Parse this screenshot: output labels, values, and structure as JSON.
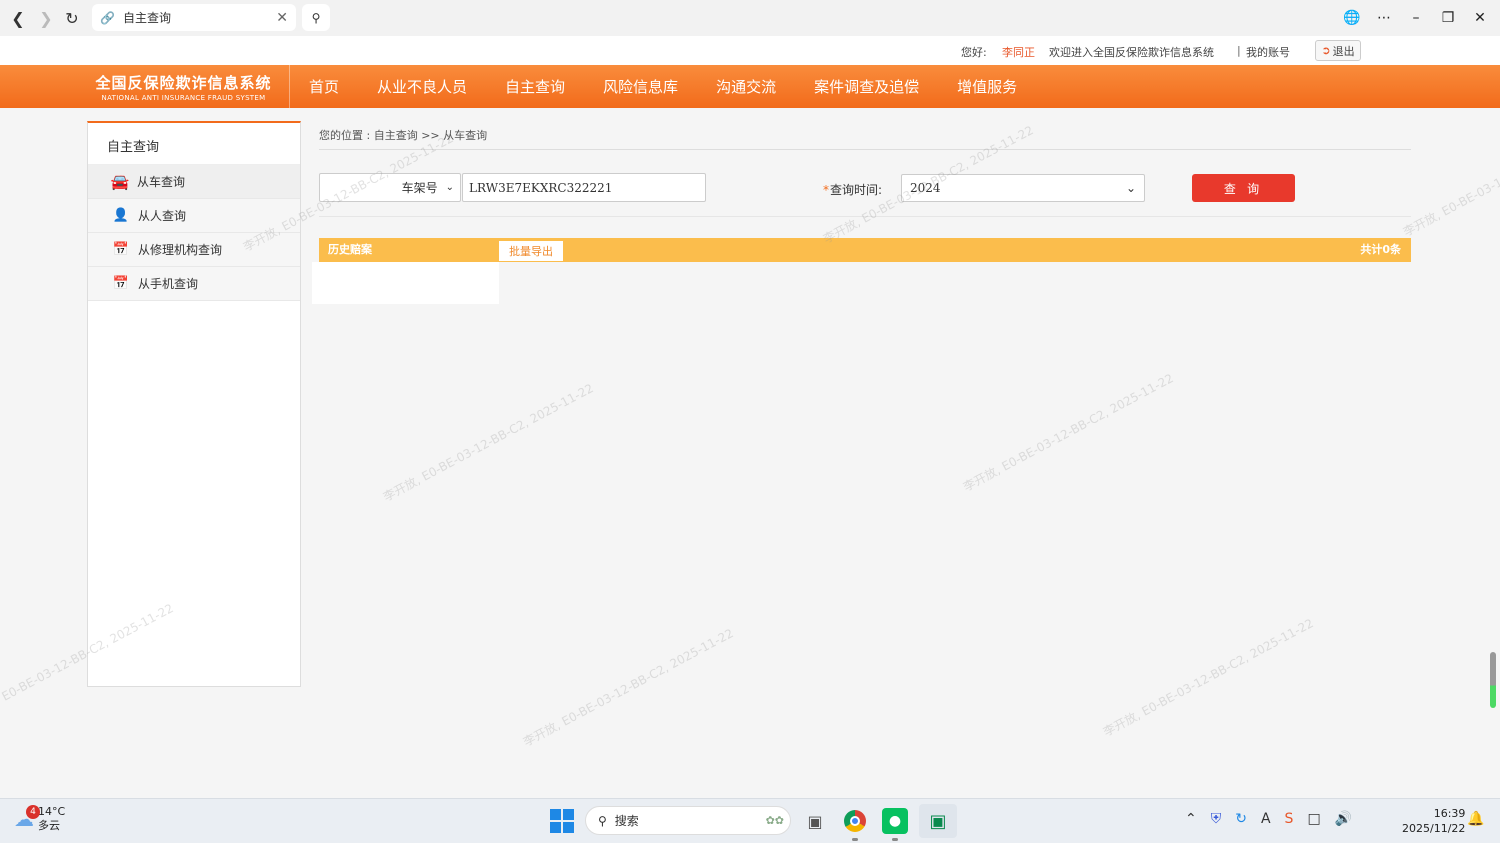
{
  "browser": {
    "tab_title": "自主查询"
  },
  "top_info": {
    "greeting": "您好:",
    "username": "李同正",
    "welcome": "欢迎进入全国反保险欺诈信息系统",
    "separator": "|",
    "my_account": "我的账号",
    "logout": "退出"
  },
  "logo": {
    "cn": "全国反保险欺诈信息系统",
    "en": "NATIONAL ANTI INSURANCE FRAUD SYSTEM"
  },
  "nav": {
    "items": [
      "首页",
      "从业不良人员",
      "自主查询",
      "风险信息库",
      "沟通交流",
      "案件调查及追偿",
      "增值服务"
    ]
  },
  "sidebar": {
    "title": "自主查询",
    "items": [
      {
        "label": "从车查询",
        "icon": "car-icon"
      },
      {
        "label": "从人查询",
        "icon": "person-icon"
      },
      {
        "label": "从修理机构查询",
        "icon": "repair-shop-icon"
      },
      {
        "label": "从手机查询",
        "icon": "phone-icon"
      }
    ]
  },
  "content": {
    "breadcrumb": "您的位置 : 自主查询 >> 从车查询",
    "query_type": "车架号",
    "vin_value": "LRW3E7EKXRC322221",
    "time_label": "查询时间:",
    "time_star": "*",
    "time_value": "2024",
    "query_button": "查 询",
    "history_tab": "历史赔案",
    "export_button": "批量导出",
    "total": "共计0条"
  },
  "watermark": "李开放, E0-BE-03-12-BB-C2, 2025-11-22",
  "taskbar": {
    "weather_badge": "4",
    "weather_temp": "14°C",
    "weather_desc": "多云",
    "search_label": "搜索",
    "time": "16:39",
    "date": "2025/11/22"
  }
}
